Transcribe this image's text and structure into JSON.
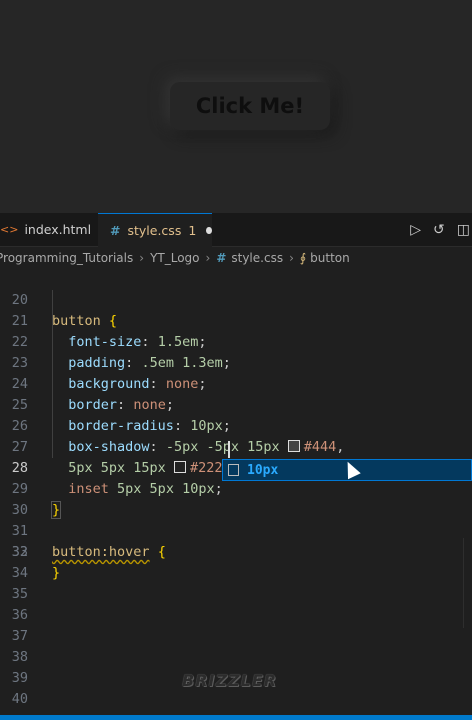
{
  "preview": {
    "button_label": "Click Me!"
  },
  "tabs": [
    {
      "label": "index.html"
    },
    {
      "label": "style.css",
      "problems": "1"
    }
  ],
  "breadcrumb": [
    "Programming_Tutorials",
    "YT_Logo",
    "style.css",
    "button"
  ],
  "lines": [
    {
      "n": "20"
    },
    {
      "n": "21"
    },
    {
      "n": "22"
    },
    {
      "n": "23"
    },
    {
      "n": "24"
    },
    {
      "n": "25"
    },
    {
      "n": "26"
    },
    {
      "n": "27"
    },
    {
      "n": "28"
    },
    {
      "n": "29"
    },
    {
      "n": "30"
    },
    {
      "n": "31"
    },
    {
      "n": "32"
    },
    {
      "n": "33"
    },
    {
      "n": "34"
    },
    {
      "n": "35"
    },
    {
      "n": "36"
    },
    {
      "n": "37"
    },
    {
      "n": "38"
    },
    {
      "n": "39"
    },
    {
      "n": "40"
    }
  ],
  "code": {
    "l20_sel": "button",
    "l20_brace": "{",
    "l21_prop": "font-size",
    "l21_val": "1.5em",
    "l22_prop": "padding",
    "l22_val": ".5em 1.3em",
    "l23_prop": "background",
    "l23_val": "none",
    "l24_prop": "border",
    "l24_val": "none",
    "l25_prop": "border-radius",
    "l25_val": "10px",
    "l26_prop": "box-shadow",
    "l26_val": "-5px -5px 15px",
    "l26_color": "#444",
    "l27_val": "5px 5px 15px",
    "l27_color": "#222",
    "l28_kw": "inset",
    "l28_val": "5px 5px 10px",
    "l30_brace": "}",
    "l31_sel": "button:hover",
    "l31_brace": "{",
    "l32_brace": "}"
  },
  "suggestion": {
    "label": "10px"
  },
  "watermark": "BRIZZLER",
  "colors": {
    "accent": "#0078d4",
    "statusbar": "#007acc"
  }
}
